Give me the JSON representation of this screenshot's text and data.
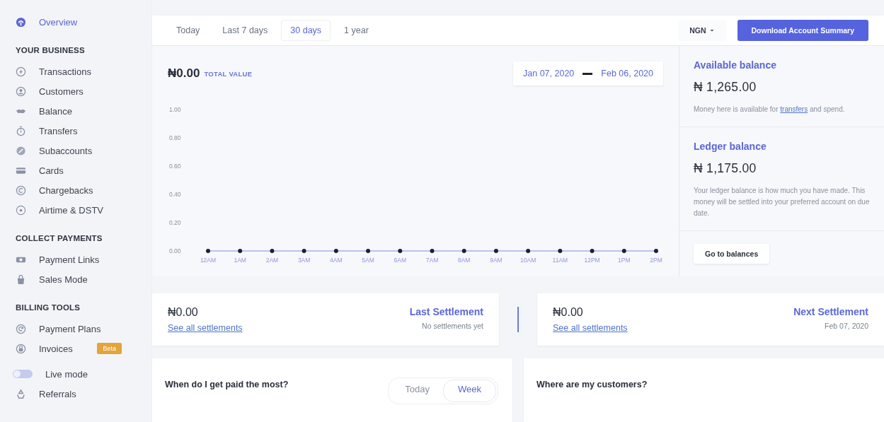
{
  "sidebar": {
    "overview": {
      "label": "Overview",
      "selected": true
    },
    "sections": [
      {
        "heading": "YOUR BUSINESS",
        "items": [
          {
            "label": "Transactions",
            "selected": false
          },
          {
            "label": "Customers",
            "selected": false
          },
          {
            "label": "Balance",
            "selected": false
          },
          {
            "label": "Transfers",
            "selected": false
          },
          {
            "label": "Subaccounts",
            "selected": false
          },
          {
            "label": "Cards",
            "selected": false
          },
          {
            "label": "Chargebacks",
            "selected": false
          },
          {
            "label": "Airtime & DSTV",
            "selected": false
          }
        ]
      },
      {
        "heading": "COLLECT PAYMENTS",
        "items": [
          {
            "label": "Payment Links",
            "selected": false
          },
          {
            "label": "Sales Mode",
            "selected": false
          }
        ]
      },
      {
        "heading": "BILLING TOOLS",
        "items": [
          {
            "label": "Payment Plans",
            "selected": false
          },
          {
            "label": "Invoices",
            "selected": false,
            "badge": "Beta"
          }
        ]
      }
    ],
    "live_mode": {
      "label": "Live mode",
      "on": false
    },
    "referrals": {
      "label": "Referrals",
      "selected": false
    }
  },
  "toolbar": {
    "tabs": [
      {
        "label": "Today",
        "selected": false
      },
      {
        "label": "Last 7 days",
        "selected": false
      },
      {
        "label": "30 days",
        "selected": true
      },
      {
        "label": "1 year",
        "selected": false
      }
    ],
    "currency": "NGN",
    "download_button": "Download Account Summary"
  },
  "chart_card": {
    "amount": "₦0.00",
    "amount_label": "TOTAL VALUE",
    "date_from": "Jan 07, 2020",
    "date_to": "Feb 06, 2020",
    "chart_data": {
      "type": "line",
      "categories": [
        "12AM",
        "1AM",
        "2AM",
        "3AM",
        "4AM",
        "5AM",
        "6AM",
        "7AM",
        "8AM",
        "9AM",
        "10AM",
        "11AM",
        "12PM",
        "1PM",
        "2PM"
      ],
      "series": [
        {
          "color": "#aab1e3",
          "marker": "circle",
          "values": [
            0,
            0,
            0,
            0,
            0,
            0,
            0,
            0,
            0,
            0,
            0,
            0,
            0,
            0,
            0
          ]
        }
      ],
      "ylim": [
        0,
        1
      ],
      "yticks": [
        {
          "value": 0,
          "label": "0.00"
        },
        {
          "value": 0.2,
          "label": "0.20"
        },
        {
          "value": 0.4,
          "label": "0.40"
        },
        {
          "value": 0.6,
          "label": "0.60"
        },
        {
          "value": 0.8,
          "label": "0.80"
        },
        {
          "value": 1,
          "label": "1.00"
        }
      ]
    }
  },
  "balances": [
    {
      "title": "Available balance",
      "amount": "₦ 1,265.00",
      "note_before": "Money here is available for ",
      "note_link": "transfers",
      "note_after": " and spend."
    },
    {
      "title": "Ledger balance",
      "amount": "₦ 1,175.00",
      "note_before": "Your ledger balance is how much you have made. This money will be settled into your preferred account on due date."
    }
  ],
  "balances_button": "Go to balances",
  "settlements": [
    {
      "amount": "₦0.00",
      "link": "See all settlements",
      "title": "Last Settlement",
      "detail": "No settlements yet"
    },
    {
      "amount": "₦0.00",
      "link": "See all settlements",
      "title": "Next Settlement",
      "detail": "Feb 07, 2020"
    }
  ],
  "insights": [
    {
      "title": "When do I get paid the most?",
      "periods": [
        {
          "label": "Today",
          "selected": false
        },
        {
          "label": "Week",
          "selected": true
        }
      ]
    },
    {
      "title": "Where are my customers?"
    }
  ]
}
